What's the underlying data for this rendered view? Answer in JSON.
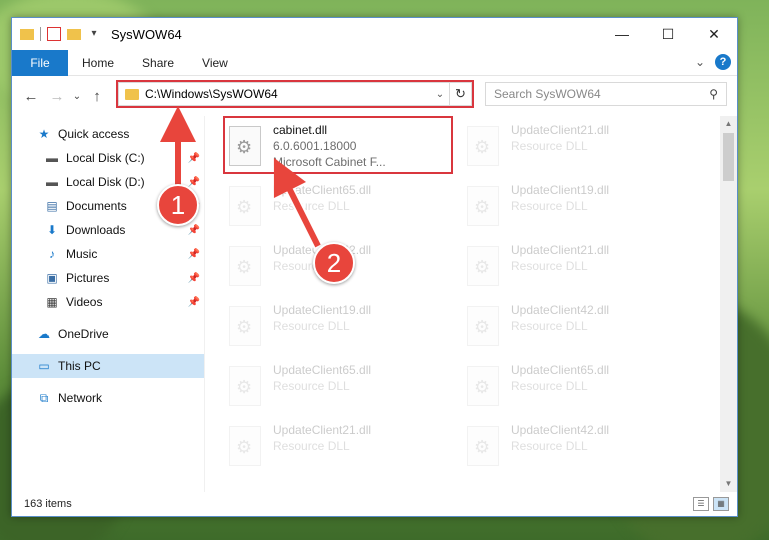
{
  "window": {
    "title": "SysWOW64",
    "controls": {
      "minimize": "—",
      "maximize": "☐",
      "close": "✕"
    }
  },
  "ribbon": {
    "tabs": [
      "File",
      "Home",
      "Share",
      "View"
    ],
    "expand": "⌄",
    "help": "?"
  },
  "navigation": {
    "back": "←",
    "forward": "→",
    "recent": "⌄",
    "up": "↑"
  },
  "address": {
    "path": "C:\\Windows\\SysWOW64",
    "dropdown": "⌄",
    "refresh": "↻"
  },
  "search": {
    "placeholder": "Search SysWOW64",
    "icon": "search-icon"
  },
  "sidebar": {
    "items": [
      {
        "label": "Quick access",
        "icon": "star-icon",
        "glyph": "★",
        "color": "#1979ca",
        "pinned": false
      },
      {
        "label": "Local Disk (C:)",
        "icon": "drive-icon",
        "glyph": "▬",
        "color": "#555555",
        "pinned": true
      },
      {
        "label": "Local Disk (D:)",
        "icon": "drive-icon",
        "glyph": "▬",
        "color": "#555555",
        "pinned": true
      },
      {
        "label": "Documents",
        "icon": "documents-icon",
        "glyph": "▤",
        "color": "#3a6ea5",
        "pinned": true
      },
      {
        "label": "Downloads",
        "icon": "downloads-icon",
        "glyph": "⬇",
        "color": "#1979ca",
        "pinned": true
      },
      {
        "label": "Music",
        "icon": "music-icon",
        "glyph": "♪",
        "color": "#1979ca",
        "pinned": true
      },
      {
        "label": "Pictures",
        "icon": "pictures-icon",
        "glyph": "▣",
        "color": "#3a6ea5",
        "pinned": true
      },
      {
        "label": "Videos",
        "icon": "videos-icon",
        "glyph": "▦",
        "color": "#3a3a3a",
        "pinned": true
      }
    ],
    "onedrive": {
      "label": "OneDrive",
      "icon": "onedrive-icon",
      "glyph": "☁",
      "color": "#1979ca"
    },
    "thispc": {
      "label": "This PC",
      "icon": "computer-icon",
      "glyph": "▭",
      "color": "#1979ca"
    },
    "network": {
      "label": "Network",
      "icon": "network-icon",
      "glyph": "⧉",
      "color": "#1979ca"
    },
    "pin_glyph": "📌"
  },
  "files": [
    {
      "name": "cabinet.dll",
      "line2": "6.0.6001.18000",
      "line3": "Microsoft Cabinet F...",
      "faded": false
    },
    {
      "name": "UpdateClient21.dll",
      "line2": "Resource DLL",
      "line3": "",
      "faded": true
    },
    {
      "name": "UpdateClient65.dll",
      "line2": "Resource DLL",
      "line3": "",
      "faded": true
    },
    {
      "name": "UpdateClient19.dll",
      "line2": "Resource DLL",
      "line3": "",
      "faded": true
    },
    {
      "name": "UpdateClient42.dll",
      "line2": "Resource DLL",
      "line3": "",
      "faded": true
    },
    {
      "name": "UpdateClient21.dll",
      "line2": "Resource DLL",
      "line3": "",
      "faded": true
    },
    {
      "name": "UpdateClient19.dll",
      "line2": "Resource DLL",
      "line3": "",
      "faded": true
    },
    {
      "name": "UpdateClient42.dll",
      "line2": "Resource DLL",
      "line3": "",
      "faded": true
    },
    {
      "name": "UpdateClient65.dll",
      "line2": "Resource DLL",
      "line3": "",
      "faded": true
    },
    {
      "name": "UpdateClient65.dll",
      "line2": "Resource DLL",
      "line3": "",
      "faded": true
    },
    {
      "name": "UpdateClient21.dll",
      "line2": "Resource DLL",
      "line3": "",
      "faded": true
    },
    {
      "name": "UpdateClient42.dll",
      "line2": "Resource DLL",
      "line3": "",
      "faded": true
    }
  ],
  "status": {
    "item_count": "163 items"
  },
  "annotations": {
    "step1": "1",
    "step2": "2",
    "highlight_color": "#d9363e",
    "badge_color": "#e8453c"
  },
  "colors": {
    "accent": "#1979ca",
    "selection": "#cce4f7"
  }
}
